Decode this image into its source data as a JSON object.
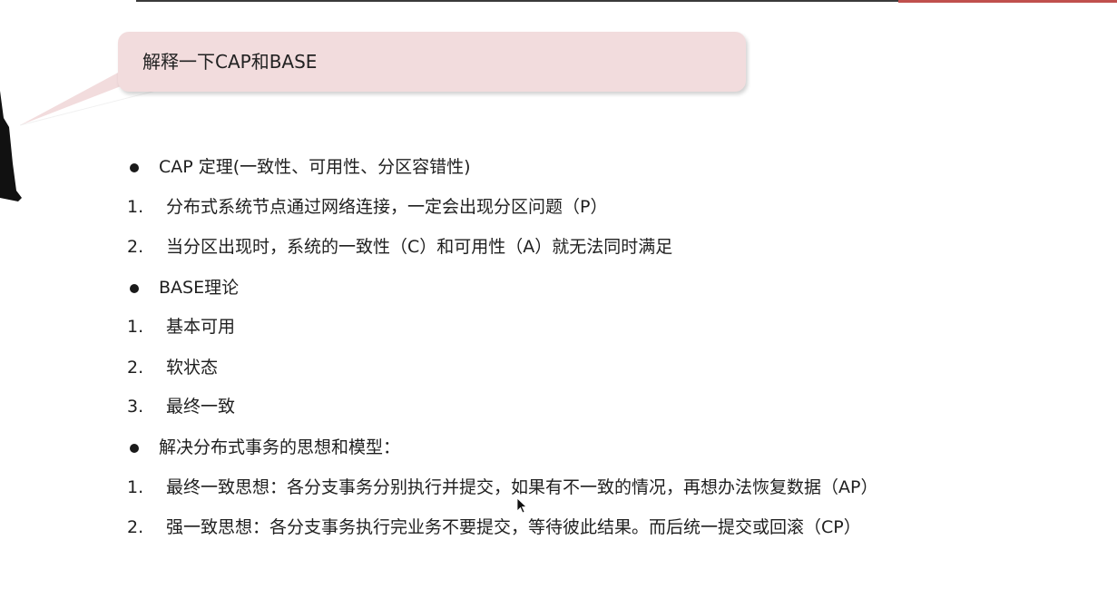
{
  "question": "解释一下CAP和BASE",
  "lines": [
    {
      "type": "bullet",
      "marker": "",
      "text": "CAP 定理(一致性、可用性、分区容错性)"
    },
    {
      "type": "num",
      "marker": "1.",
      "text": "分布式系统节点通过网络连接，一定会出现分区问题（P）"
    },
    {
      "type": "num",
      "marker": "2.",
      "text": "当分区出现时，系统的一致性（C）和可用性（A）就无法同时满足"
    },
    {
      "type": "bullet",
      "marker": "",
      "text": "BASE理论"
    },
    {
      "type": "num",
      "marker": "1.",
      "text": "基本可用"
    },
    {
      "type": "num",
      "marker": "2.",
      "text": "软状态"
    },
    {
      "type": "num",
      "marker": "3.",
      "text": "最终一致"
    },
    {
      "type": "bullet",
      "marker": "",
      "text": "解决分布式事务的思想和模型："
    },
    {
      "type": "num",
      "marker": "1.",
      "text": "最终一致思想：各分支事务分别执行并提交，如果有不一致的情况，再想办法恢复数据（AP）"
    },
    {
      "type": "num",
      "marker": "2.",
      "text": "强一致思想：各分支事务执行完业务不要提交，等待彼此结果。而后统一提交或回滚（CP）"
    }
  ],
  "colors": {
    "bubble": "#f2dcdd",
    "accent": "#c0504d",
    "text": "#1f1f1f"
  }
}
